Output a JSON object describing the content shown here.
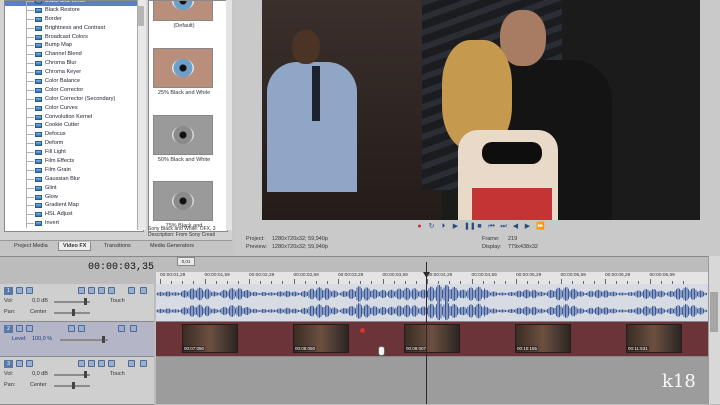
{
  "fx_tree": {
    "items": [
      "Black and White",
      "Black Restore",
      "Border",
      "Brightness and Contrast",
      "Broadcast Colors",
      "Bump Map",
      "Channel Blend",
      "Chroma Blur",
      "Chroma Keyer",
      "Color Balance",
      "Color Corrector",
      "Color Corrector (Secondary)",
      "Color Curves",
      "Convolution Kernel",
      "Cookie Cutter",
      "Defocus",
      "Deform",
      "Fill Light",
      "Film Effects",
      "Film Grain",
      "Gaussian Blur",
      "Glint",
      "Glow",
      "Gradient Map",
      "HSL Adjust",
      "Invert"
    ]
  },
  "presets": [
    {
      "label": "(Default)"
    },
    {
      "label": "25% Black and White"
    },
    {
      "label": "50% Black and White"
    },
    {
      "label": "75% Black and"
    }
  ],
  "preset_description": "Sony Black and White: OFX, 3 Description: From Sony Creati",
  "tabs": [
    "Project Media",
    "Video FX",
    "Transitions",
    "Media Generators"
  ],
  "preview_info": {
    "project_label": "Project:",
    "project_value": "1280x720x32; 59,940p",
    "preview_label": "Preview:",
    "preview_value": "1280x720x32; 59,940p",
    "frame_label": "Frame:",
    "frame_value": "219",
    "display_label": "Display:",
    "display_value": "779x438x32"
  },
  "timeline": {
    "time_code": "00:00:03,35",
    "marker": "0,01",
    "ruler_labels": [
      "00:00:01,29",
      "00:00:01,59",
      "00:00:02,29",
      "00:00:02,59",
      "00:00:03,29",
      "00:00:03,59",
      "00:00:04,29",
      "00:00:04,59",
      "00:00:05,29",
      "00:00:05,59",
      "00:00:06,29",
      "00:00:06,59"
    ]
  },
  "tracks": {
    "audio1": {
      "num": "1",
      "vol_label": "Vol:",
      "vol_value": "0,0 dB",
      "pan_label": "Pan:",
      "pan_value": "Center",
      "mode": "Touch"
    },
    "video2": {
      "num": "2",
      "level_label": "Level:",
      "level_value": "100,0 %"
    },
    "audio3": {
      "num": "3",
      "vol_label": "Vol:",
      "vol_value": "0,0 dB",
      "pan_label": "Pan:",
      "pan_value": "Center",
      "mode": "Touch"
    }
  },
  "clips": [
    {
      "label": "00:07:050"
    },
    {
      "label": "00:08:050"
    },
    {
      "label": "00:09:007"
    },
    {
      "label": "00:10:155"
    },
    {
      "label": "00:11:531"
    }
  ],
  "watermark": "k18",
  "colors": {
    "selection": "#5b7fbf",
    "video_track": "#6b3438",
    "waveform": "#3b5a99"
  }
}
